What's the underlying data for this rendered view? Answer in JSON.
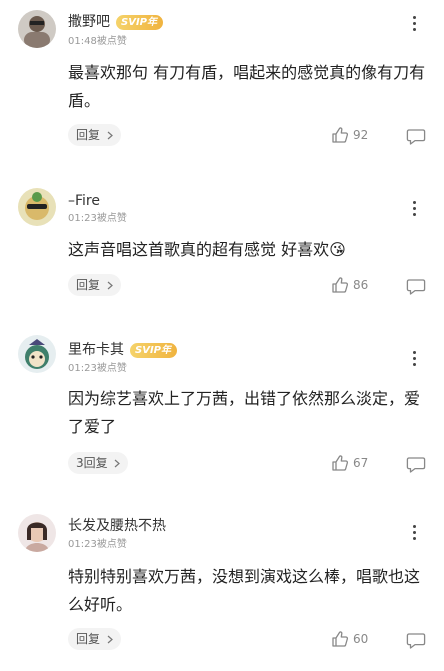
{
  "comments": [
    {
      "username": "撒野吧",
      "vip": "SVIP年",
      "meta": "01:48被点赞",
      "text": "最喜欢那句  有刀有盾，唱起来的感觉真的像有刀有盾。",
      "reply_label": "回复",
      "likes": "92"
    },
    {
      "username": "–Fire",
      "vip": "",
      "meta": "01:23被点赞",
      "text": "这声音唱这首歌真的超有感觉 好喜欢😘",
      "reply_label": "回复",
      "likes": "86"
    },
    {
      "username": "里布卡其",
      "vip": "SVIP年",
      "meta": "01:23被点赞",
      "text": "因为综艺喜欢上了万茜，出错了依然那么淡定，爱了爱了",
      "reply_label": "3回复",
      "likes": "67"
    },
    {
      "username": "长发及腰热不热",
      "vip": "",
      "meta": "01:23被点赞",
      "text": "特别特别喜欢万茜，没想到演戏这么棒，唱歌也这么好听。",
      "reply_label": "回复",
      "likes": "60"
    }
  ],
  "icons": {
    "more": "more-vertical-icon",
    "like": "thumbs-up-icon",
    "comment": "comment-bubble-icon",
    "chevron": "chevron-right-icon"
  },
  "colors": {
    "vip_gold": "#f0b33f",
    "meta_gray": "#999999",
    "reply_bg": "#f3f3f3"
  }
}
